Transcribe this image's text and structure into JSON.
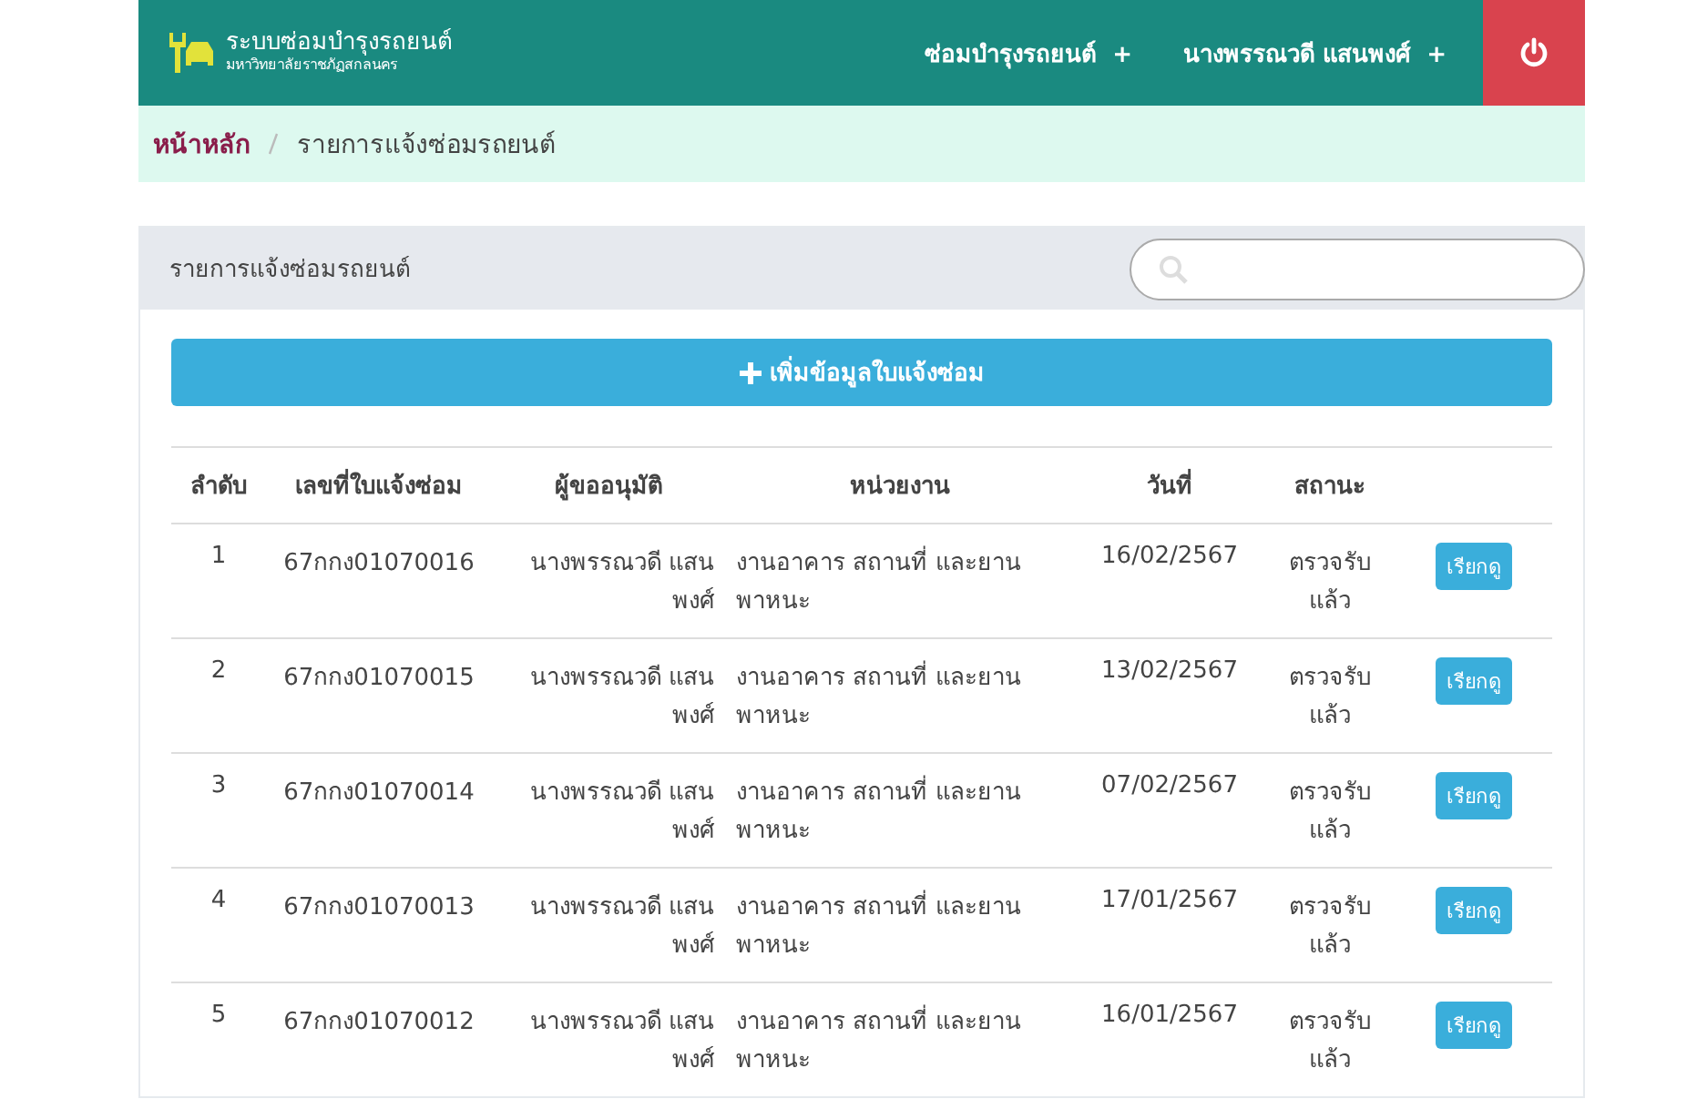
{
  "navbar": {
    "title": "ระบบซ่อมบำรุงรถยนต์",
    "subtitle": "มหาวิทยาลัยราชภัฏสกลนคร",
    "menus": [
      {
        "label": "ซ่อมบำรุงรถยนต์",
        "icon": "+"
      },
      {
        "label": "นางพรรณวดี แสนพงศ์",
        "icon": "+"
      }
    ]
  },
  "breadcrumb": [
    {
      "label": "หน้าหลัก",
      "selected": false
    },
    {
      "label": "รายการแจ้งซ่อมรถยนต์",
      "selected": true
    }
  ],
  "panel": {
    "title": "รายการแจ้งซ่อมรถยนต์",
    "add_button": "เพิ่มข้อมูลใบแจ้งซ่อม"
  },
  "table": {
    "columns": [
      "ลำดับ",
      "เลขที่ใบแจ้งซ่อม",
      "ผู้ขออนุมัติ",
      "หน่วยงาน",
      "วันที่",
      "สถานะ"
    ],
    "rows": [
      {
        "no": "1",
        "doc": "67กกง01070016",
        "requester": "นางพรรณวดี แสนพงศ์",
        "unit": "งานอาคาร สถานที่ และยานพาหนะ",
        "date": "16/02/2567",
        "status": "ตรวจรับแล้ว",
        "action": "เรียกดู"
      },
      {
        "no": "2",
        "doc": "67กกง01070015",
        "requester": "นางพรรณวดี แสนพงศ์",
        "unit": "งานอาคาร สถานที่ และยานพาหนะ",
        "date": "13/02/2567",
        "status": "ตรวจรับแล้ว",
        "action": "เรียกดู"
      },
      {
        "no": "3",
        "doc": "67กกง01070014",
        "requester": "นางพรรณวดี แสนพงศ์",
        "unit": "งานอาคาร สถานที่ และยานพาหนะ",
        "date": "07/02/2567",
        "status": "ตรวจรับแล้ว",
        "action": "เรียกดู"
      },
      {
        "no": "4",
        "doc": "67กกง01070013",
        "requester": "นางพรรณวดี แสนพงศ์",
        "unit": "งานอาคาร สถานที่ และยานพาหนะ",
        "date": "17/01/2567",
        "status": "ตรวจรับแล้ว",
        "action": "เรียกดู"
      },
      {
        "no": "5",
        "doc": "67กกง01070012",
        "requester": "นางพรรณวดี แสนพงศ์",
        "unit": "งานอาคาร สถานที่ และยานพาหนะ",
        "date": "16/01/2567",
        "status": "ตรวจรับแล้ว",
        "action": "เรียกดู"
      }
    ]
  }
}
